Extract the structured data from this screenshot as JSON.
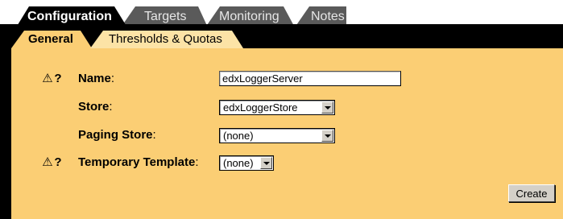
{
  "top_tabs": [
    {
      "label": "Configuration",
      "active": true
    },
    {
      "label": "Targets",
      "active": false
    },
    {
      "label": "Monitoring",
      "active": false
    },
    {
      "label": "Notes",
      "active": false
    }
  ],
  "sub_tabs": [
    {
      "label": "General",
      "active": true
    },
    {
      "label": "Thresholds & Quotas",
      "active": false
    }
  ],
  "form": {
    "name_label": "Name",
    "name_value": "edxLoggerServer",
    "store_label": "Store",
    "store_value": "edxLoggerStore",
    "paging_store_label": "Paging Store",
    "paging_store_value": "(none)",
    "temporary_template_label": "Temporary Template",
    "temporary_template_value": "(none)",
    "colon": ":"
  },
  "buttons": {
    "create_label": "Create"
  },
  "icons": {
    "warning": "warning-icon",
    "help": "help-icon",
    "warning_glyph": "⚠",
    "help_glyph": "?"
  },
  "colors": {
    "panel": "#fbce74",
    "tab_dark": "#555555",
    "band": "#000000"
  }
}
